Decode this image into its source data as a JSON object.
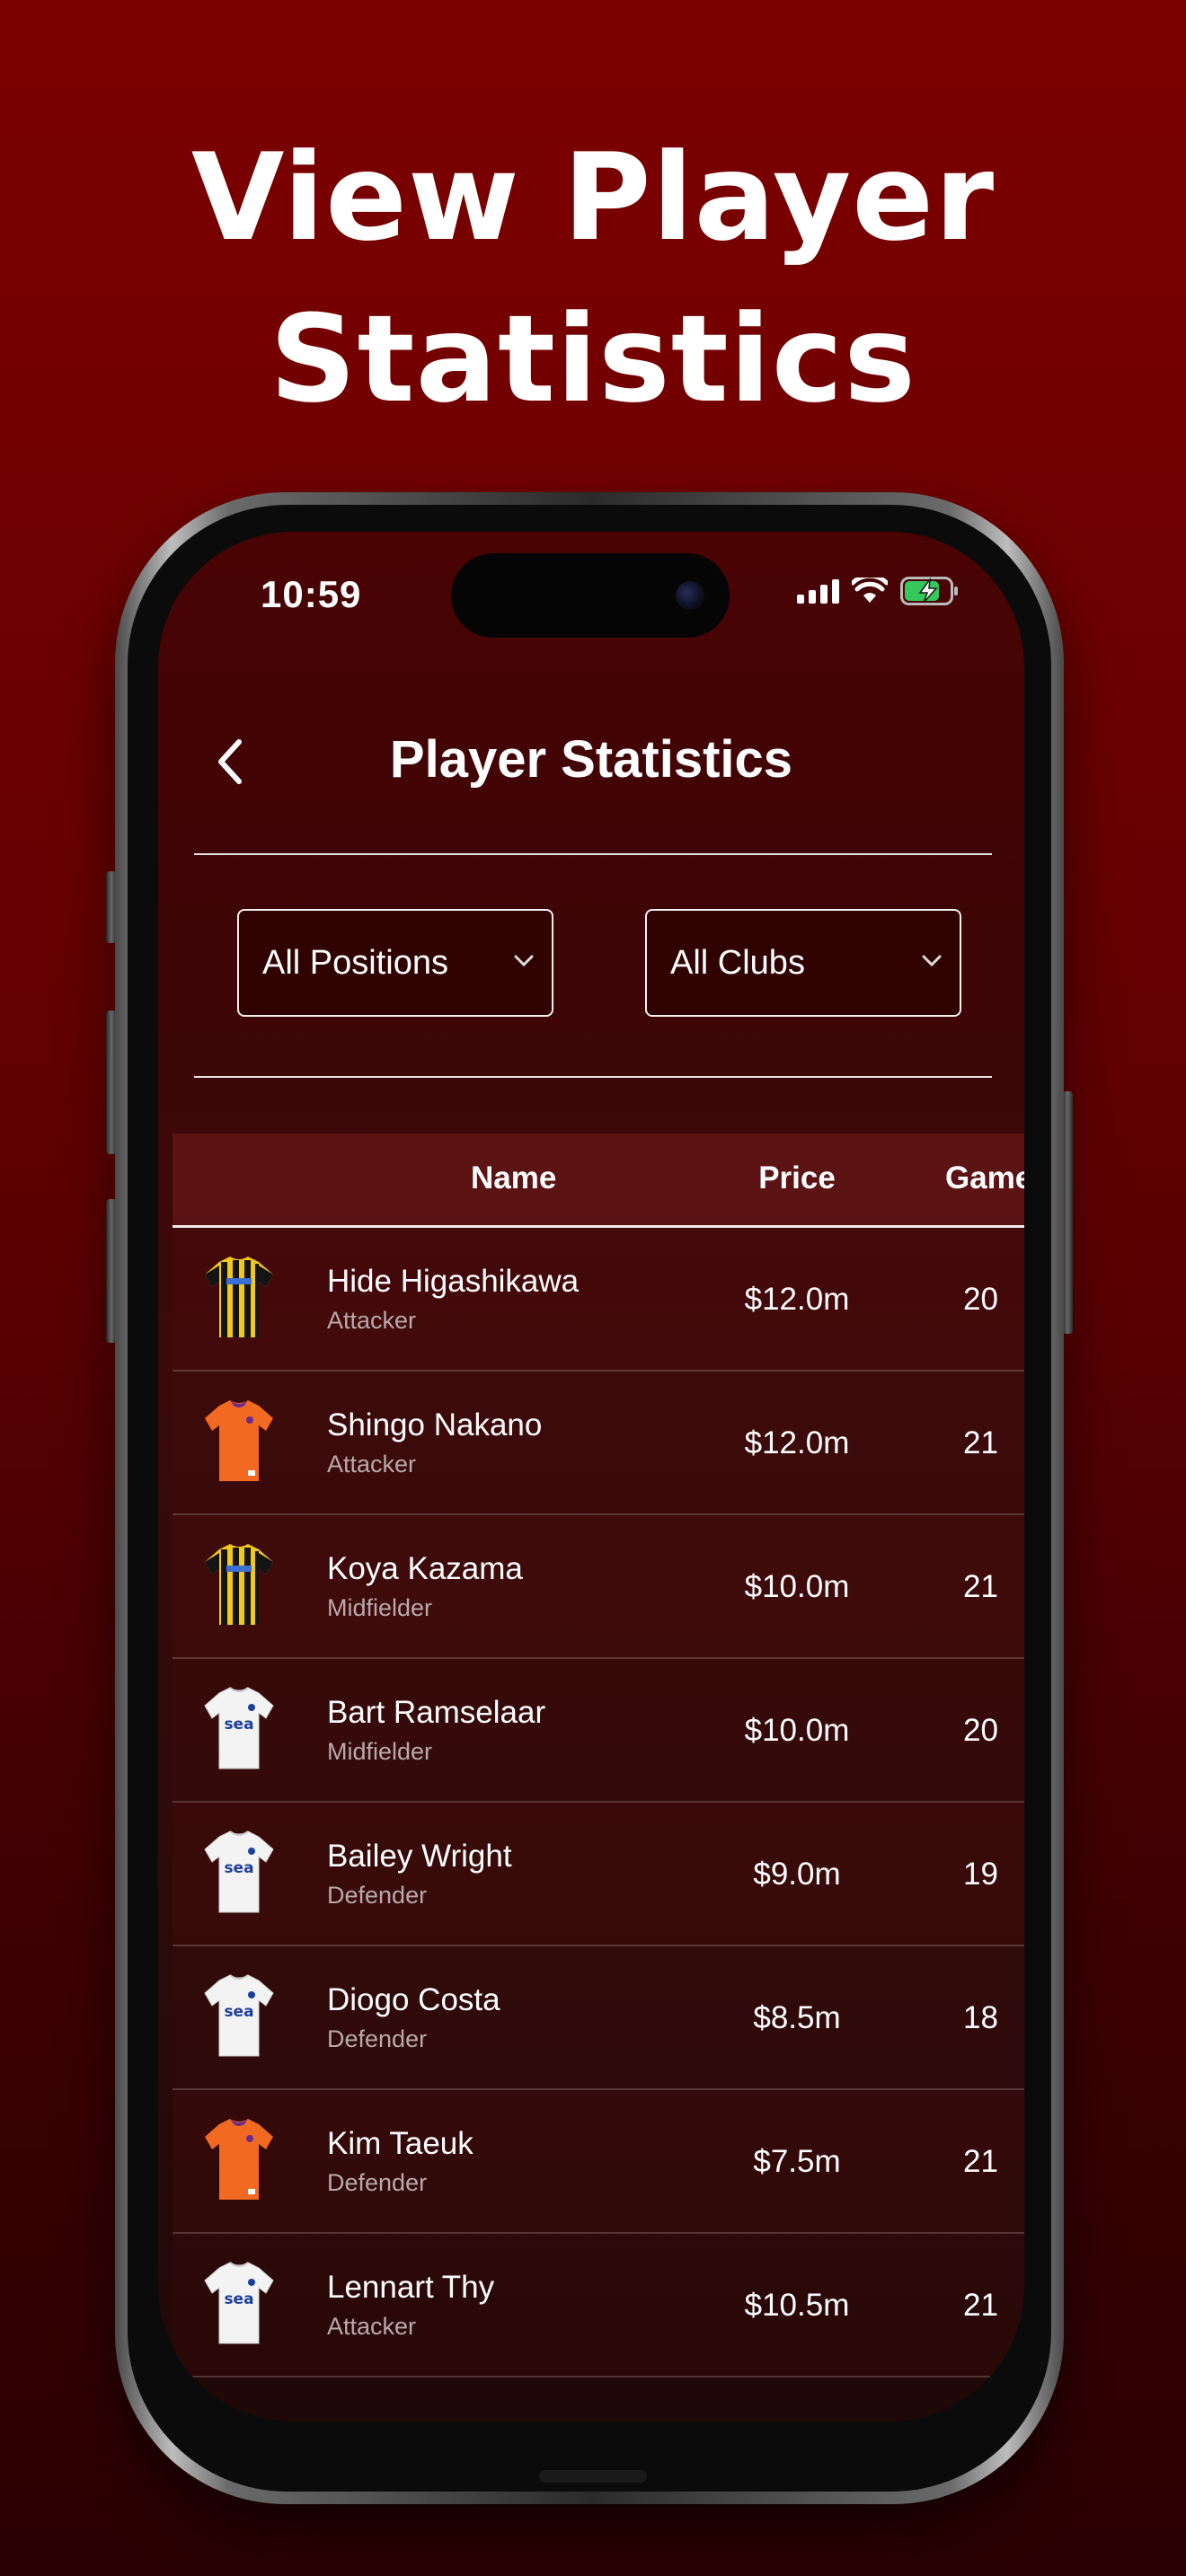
{
  "headline": {
    "line1": "View Player",
    "line2": "Statistics"
  },
  "status_bar": {
    "time": "10:59"
  },
  "header": {
    "title": "Player Statistics"
  },
  "filters": {
    "position": "All Positions",
    "club": "All Clubs"
  },
  "table": {
    "columns": [
      "Name",
      "Price",
      "Game"
    ],
    "rows": [
      {
        "name": "Hide Higashikawa",
        "position": "Attacker",
        "price": "$12.0m",
        "games": "20",
        "kit": "yellow-black-striped"
      },
      {
        "name": "Shingo Nakano",
        "position": "Attacker",
        "price": "$12.0m",
        "games": "21",
        "kit": "orange"
      },
      {
        "name": "Koya Kazama",
        "position": "Midfielder",
        "price": "$10.0m",
        "games": "21",
        "kit": "yellow-black-striped"
      },
      {
        "name": "Bart Ramselaar",
        "position": "Midfielder",
        "price": "$10.0m",
        "games": "20",
        "kit": "white-sea"
      },
      {
        "name": "Bailey Wright",
        "position": "Defender",
        "price": "$9.0m",
        "games": "19",
        "kit": "white-sea"
      },
      {
        "name": "Diogo Costa",
        "position": "Defender",
        "price": "$8.5m",
        "games": "18",
        "kit": "white-sea"
      },
      {
        "name": "Kim Taeuk",
        "position": "Defender",
        "price": "$7.5m",
        "games": "21",
        "kit": "orange"
      },
      {
        "name": "Lennart Thy",
        "position": "Attacker",
        "price": "$10.5m",
        "games": "21",
        "kit": "white-sea"
      }
    ]
  },
  "colors": {
    "background": "#7d0000",
    "screen": "#3f0506",
    "battery": "#34c759"
  },
  "icons": {
    "back": "chevron-left-icon",
    "dropdown": "chevron-down-icon",
    "signal": "cellular-signal-icon",
    "wifi": "wifi-icon",
    "battery": "battery-charging-icon"
  },
  "kit_labels": {
    "white_sea": "sea"
  }
}
